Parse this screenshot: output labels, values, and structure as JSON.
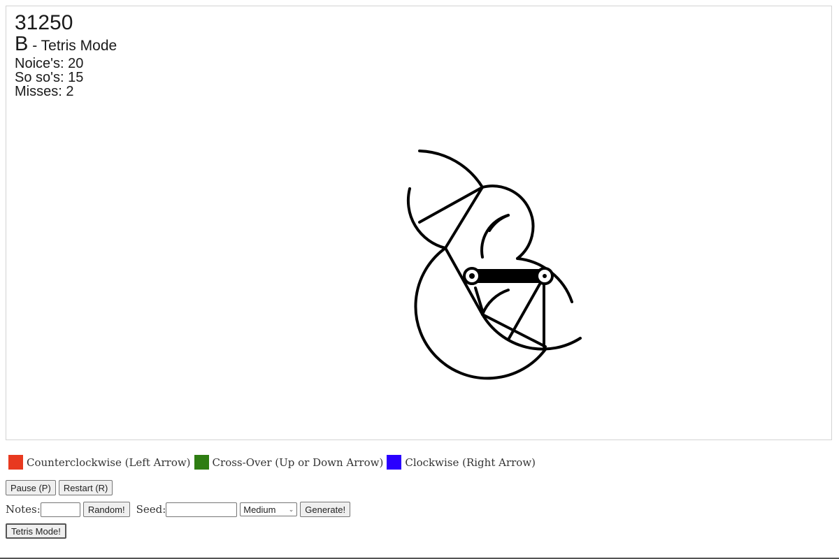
{
  "hud": {
    "score": "31250",
    "grade": "B",
    "mode_suffix": "- Tetris Mode",
    "noices": "Noice's: 20",
    "so_sos": "So so's: 15",
    "misses": "Misses: 2"
  },
  "legend": [
    {
      "label": "Counterclockwise (Left Arrow)",
      "color": "#e8391f"
    },
    {
      "label": "Cross-Over (Up or Down Arrow)",
      "color": "#2e7d12"
    },
    {
      "label": "Clockwise (Right Arrow)",
      "color": "#2a00ff"
    }
  ],
  "controls": {
    "pause_label": "Pause (P)",
    "restart_label": "Restart (R)",
    "notes_label": "Notes:",
    "notes_value": "",
    "random_label": "Random!",
    "seed_label": "Seed:",
    "seed_value": "",
    "difficulty_selected": "Medium",
    "generate_label": "Generate!",
    "tetris_mode_label": "Tetris Mode!"
  }
}
